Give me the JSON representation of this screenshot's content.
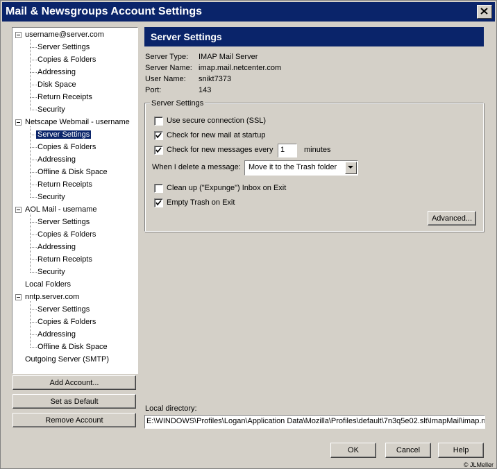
{
  "window": {
    "title": "Mail & Newsgroups Account Settings"
  },
  "tree": {
    "accounts": [
      {
        "label": "username@server.com",
        "children": [
          "Server Settings",
          "Copies & Folders",
          "Addressing",
          "Disk Space",
          "Return Receipts",
          "Security"
        ]
      },
      {
        "label": "Netscape Webmail - username",
        "children": [
          "Server Settings",
          "Copies & Folders",
          "Addressing",
          "Offline & Disk Space",
          "Return Receipts",
          "Security"
        ]
      },
      {
        "label": "AOL Mail - username",
        "children": [
          "Server Settings",
          "Copies & Folders",
          "Addressing",
          "Return Receipts",
          "Security"
        ]
      },
      {
        "label": "Local Folders",
        "children": []
      },
      {
        "label": "nntp.server.com",
        "children": [
          "Server Settings",
          "Copies & Folders",
          "Addressing",
          "Offline & Disk Space"
        ]
      },
      {
        "label": "Outgoing Server (SMTP)",
        "children": []
      }
    ],
    "selected": "1.0"
  },
  "left_buttons": {
    "add": "Add Account...",
    "default": "Set as Default",
    "remove": "Remove Account"
  },
  "panel": {
    "header": "Server Settings",
    "info": [
      {
        "key": "Server Type:",
        "value": "IMAP Mail Server"
      },
      {
        "key": "Server Name:",
        "value": "imap.mail.netcenter.com"
      },
      {
        "key": "User Name:",
        "value": "snikt7373"
      },
      {
        "key": "Port:",
        "value": "143"
      }
    ],
    "group_label": "Server Settings",
    "ssl": {
      "label": "Use secure connection (SSL)",
      "checked": false
    },
    "check_startup": {
      "label": "Check for new mail at startup",
      "checked": true
    },
    "check_every": {
      "label": "Check for new messages every",
      "checked": true,
      "value": "1",
      "unit": "minutes"
    },
    "delete_label": "When I delete a message:",
    "delete_value": "Move it to the Trash folder",
    "expunge": {
      "label": "Clean up (\"Expunge\") Inbox on Exit",
      "checked": false
    },
    "empty_trash": {
      "label": "Empty Trash on Exit",
      "checked": true
    },
    "advanced": "Advanced...",
    "local_dir_label": "Local directory:",
    "local_dir_value": "E:\\WINDOWS\\Profiles\\Logan\\Application Data\\Mozilla\\Profiles\\default\\7n3q5e02.slt\\ImapMail\\imap.mail.netcenter.com"
  },
  "dialog_buttons": {
    "ok": "OK",
    "cancel": "Cancel",
    "help": "Help"
  },
  "copyright": "© JLMeller"
}
